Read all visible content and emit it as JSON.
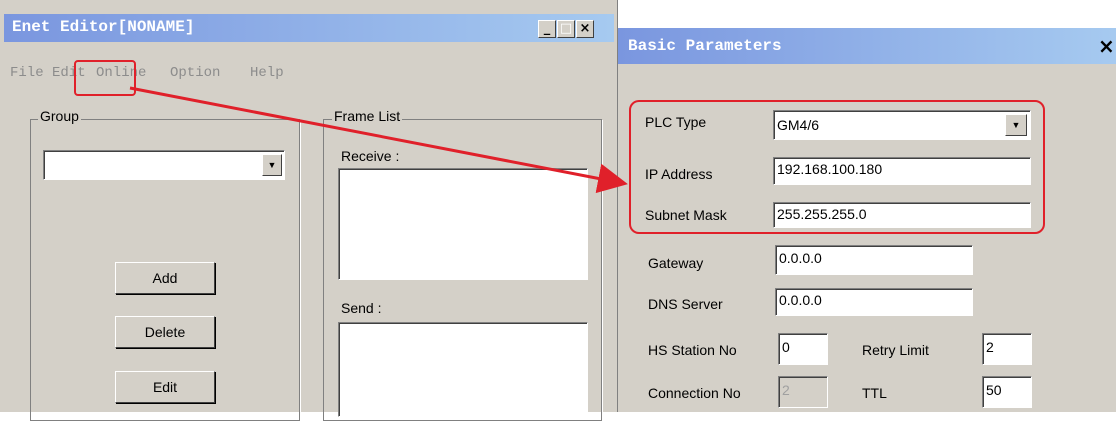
{
  "left_window": {
    "title": "Enet Editor[NONAME]",
    "controls": {
      "minimize": "_",
      "maximize": "□",
      "close": "×"
    },
    "menu": [
      {
        "label": "File"
      },
      {
        "label": "Edit"
      },
      {
        "label": "Online"
      },
      {
        "label": "Option"
      },
      {
        "label": "Help"
      }
    ],
    "group": {
      "label": "Group",
      "select_value": "",
      "buttons": {
        "add": "Add",
        "delete": "Delete",
        "edit": "Edit"
      }
    },
    "frame_list": {
      "label": "Frame List",
      "receive_label": "Receive :",
      "send_label": "Send :"
    }
  },
  "dialog": {
    "title": "Basic Parameters",
    "close": "×",
    "plc_type": {
      "label": "PLC Type",
      "value": "GM4/6"
    },
    "ip_address": {
      "label": "IP Address",
      "value": "192.168.100.180"
    },
    "subnet_mask": {
      "label": "Subnet Mask",
      "value": "255.255.255.0"
    },
    "gateway": {
      "label": "Gateway",
      "value": "0.0.0.0"
    },
    "dns_server": {
      "label": "DNS Server",
      "value": "0.0.0.0"
    },
    "hs_station_no": {
      "label": "HS Station No",
      "value": "0"
    },
    "retry_limit": {
      "label": "Retry Limit",
      "value": "2"
    },
    "connection_no": {
      "label": "Connection No",
      "value": "2"
    },
    "ttl": {
      "label": "TTL",
      "value": "50"
    }
  },
  "colors": {
    "annotation": "#e0202a",
    "titlebar_start": "#7a96df",
    "titlebar_end": "#a6caf0"
  }
}
